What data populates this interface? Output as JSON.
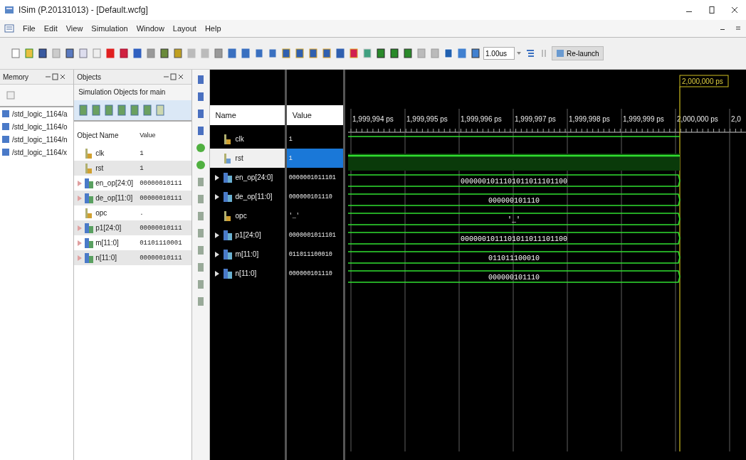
{
  "window": {
    "title": "ISim (P.20131013) - [Default.wcfg]"
  },
  "menu": [
    "File",
    "Edit",
    "View",
    "Simulation",
    "Window",
    "Layout",
    "Help"
  ],
  "toolbar": {
    "time_field": {
      "value": "1.00us"
    },
    "relaunch_button": "Re-launch"
  },
  "memory_panel": {
    "title": "Memory",
    "items": [
      "/std_logic_1164/a",
      "/std_logic_1164/o",
      "/std_logic_1164/n",
      "/std_logic_1164/x"
    ]
  },
  "objects_panel": {
    "title": "Objects",
    "subtitle": "Simulation Objects for main",
    "columns": [
      "Object Name",
      "Value"
    ],
    "rows": [
      {
        "name": "clk",
        "value": "1",
        "kind": "bit"
      },
      {
        "name": "rst",
        "value": "1",
        "kind": "bit"
      },
      {
        "name": "en_op[24:0]",
        "value": "00000010111",
        "kind": "bus"
      },
      {
        "name": "de_op[11:0]",
        "value": "00000010111",
        "kind": "bus"
      },
      {
        "name": "opc",
        "value": ".",
        "kind": "bit"
      },
      {
        "name": "p1[24:0]",
        "value": "00000010111",
        "kind": "bus"
      },
      {
        "name": "m[11:0]",
        "value": "01101110001",
        "kind": "bus"
      },
      {
        "name": "n[11:0]",
        "value": "00000010111",
        "kind": "bus"
      }
    ]
  },
  "wave": {
    "cursor_label": "2,000,000 ps",
    "columns": [
      "Name",
      "Value"
    ],
    "time_labels": [
      "1,999,994 ps",
      "1,999,995 ps",
      "1,999,996 ps",
      "1,999,997 ps",
      "1,999,998 ps",
      "1,999,999 ps",
      "2,000,000 ps",
      "2,0"
    ],
    "signals": [
      {
        "name": "clk",
        "value": "1",
        "kind": "bit",
        "expandable": false,
        "selected": false
      },
      {
        "name": "rst",
        "value": "1",
        "kind": "bit",
        "expandable": false,
        "selected": true
      },
      {
        "name": "en_op[24:0]",
        "value": "0000001011101",
        "kind": "bus",
        "expandable": true,
        "selected": false,
        "wave_label": "0000001011101011011101100"
      },
      {
        "name": "de_op[11:0]",
        "value": "000000101110",
        "kind": "bus",
        "expandable": true,
        "selected": false,
        "wave_label": "000000101110"
      },
      {
        "name": "opc",
        "value": "'_'",
        "kind": "bus",
        "expandable": false,
        "selected": false,
        "wave_label": "'_'"
      },
      {
        "name": "p1[24:0]",
        "value": "0000001011101",
        "kind": "bus",
        "expandable": true,
        "selected": false,
        "wave_label": "0000001011101011011101100"
      },
      {
        "name": "m[11:0]",
        "value": "011011100010",
        "kind": "bus",
        "expandable": true,
        "selected": false,
        "wave_label": "011011100010"
      },
      {
        "name": "n[11:0]",
        "value": "000000101110",
        "kind": "bus",
        "expandable": true,
        "selected": false,
        "wave_label": "000000101110"
      }
    ]
  }
}
